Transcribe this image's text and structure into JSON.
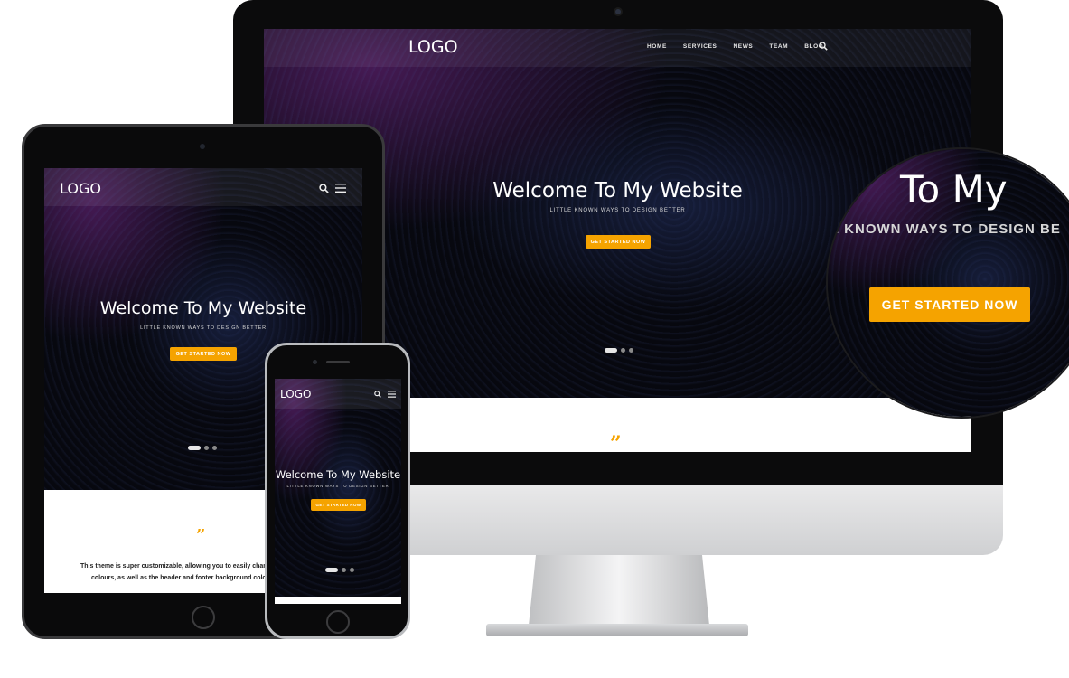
{
  "imac": {
    "logo": "LOGO",
    "nav": [
      "HOME",
      "SERVICES",
      "NEWS",
      "TEAM",
      "BLOG"
    ],
    "hero_title": "Welcome To My Website",
    "hero_subtitle": "LITTLE KNOWN WAYS TO DESIGN BETTER",
    "cta_label": "GET STARTED NOW",
    "quote_mark": "”"
  },
  "ipad": {
    "logo": "LOGO",
    "hero_title": "Welcome To My Website",
    "hero_subtitle": "LITTLE KNOWN WAYS TO DESIGN BETTER",
    "cta_label": "GET STARTED NOW",
    "quote_mark": "”",
    "testimonial_line1": "This theme is super customizable, allowing you to easily change",
    "testimonial_line2": "colours, as well as the header and footer background colo"
  },
  "phone": {
    "logo": "LOGO",
    "hero_title": "Welcome To My Website",
    "hero_subtitle": "LITTLE KNOWN WAYS TO DESIGN BETTER",
    "cta_label": "GET STARTED NOW"
  },
  "magnifier": {
    "title_fragment": "To My",
    "subtitle_fragment": "E KNOWN WAYS TO DESIGN BE",
    "cta_label": "GET STARTED NOW"
  },
  "colors": {
    "accent": "#f5a300",
    "hero_background": "#07080f",
    "frame": "#0b0b0c"
  },
  "icons": [
    "search-icon",
    "hamburger-menu-icon",
    "quote-icon"
  ]
}
